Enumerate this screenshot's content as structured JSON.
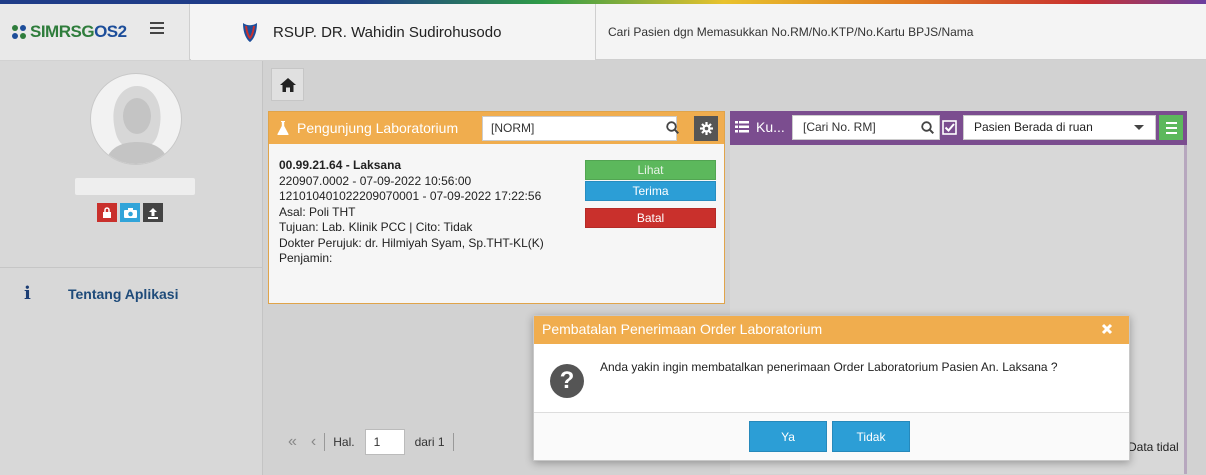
{
  "header": {
    "brand": "SIMRSGOS2",
    "brand_green": "SIMRSG",
    "brand_blue": "OS2",
    "hospital_name": "RSUP. DR. Wahidin Sudirohusodo",
    "search_hint": "Cari Pasien dgn Memasukkan No.RM/No.KTP/No.Kartu BPJS/Nama"
  },
  "sidebar": {
    "menu_label": "Tentang Aplikasi"
  },
  "panel_lab": {
    "title": "Pengunjung Laboratorium",
    "search_value": "[NORM]",
    "entry": {
      "title": "00.99.21.64 - Laksana",
      "line1": "220907.0002 - 07-09-2022 10:56:00",
      "line2": "121010401022209070001 - 07-09-2022 17:22:56",
      "asal": "Asal: Poli THT",
      "tujuan": "Tujuan: Lab. Klinik PCC | Cito: Tidak",
      "dokter": "Dokter Perujuk: dr. Hilmiyah Syam, Sp.THT-KL(K)",
      "penjamin": "Penjamin:"
    },
    "buttons": {
      "lihat": "Lihat",
      "terima": "Terima",
      "batal": "Batal"
    }
  },
  "panel_room": {
    "title": "Ku...",
    "search_value": "[Cari No. RM]",
    "select_value": "Pasien Berada di ruan"
  },
  "pager": {
    "hal_label": "Hal.",
    "page": "1",
    "of_label": "dari 1",
    "empty_text": "Data tidal"
  },
  "modal": {
    "title": "Pembatalan Penerimaan Order Laboratorium",
    "message": "Anda yakin ingin membatalkan penerimaan Order Laboratorium Pasien An. Laksana ?",
    "yes_label": "Ya",
    "no_label": "Tidak"
  },
  "colors": {
    "orange": "#f0ad4e",
    "purple": "#7b4d8f",
    "blue": "#2c9ed6",
    "green": "#5cb85c",
    "red": "#c9302c"
  }
}
